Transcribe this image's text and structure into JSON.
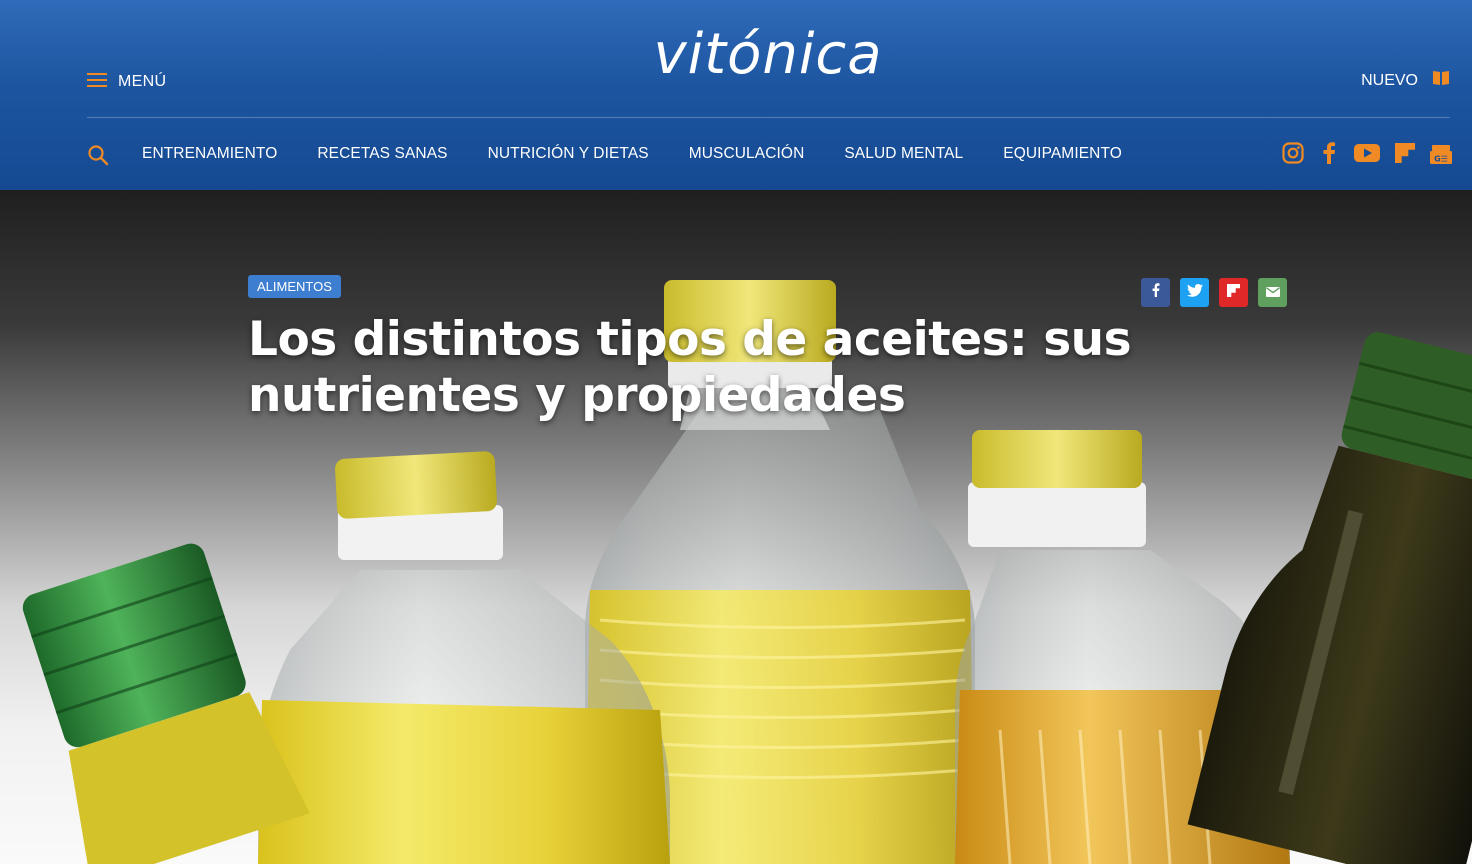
{
  "header": {
    "menu_label": "MENÚ",
    "logo_text": "vitónica",
    "nuevo_label": "NUEVO",
    "accent_color": "#f08a24"
  },
  "nav": {
    "items": [
      {
        "label": "ENTRENAMIENTO"
      },
      {
        "label": "RECETAS SANAS"
      },
      {
        "label": "NUTRICIÓN Y DIETAS"
      },
      {
        "label": "MUSCULACIÓN"
      },
      {
        "label": "SALUD MENTAL"
      },
      {
        "label": "EQUIPAMIENTO"
      }
    ],
    "socials": [
      "instagram-icon",
      "facebook-icon",
      "youtube-icon",
      "flipboard-icon",
      "google-news-icon"
    ]
  },
  "article": {
    "category": "ALIMENTOS",
    "title": "Los distintos tipos de aceites: sus nutrientes y propiedades",
    "share": [
      {
        "icon": "facebook-icon",
        "color": "#3b5998"
      },
      {
        "icon": "twitter-icon",
        "color": "#1da1f2"
      },
      {
        "icon": "flipboard-icon",
        "color": "#e12828"
      },
      {
        "icon": "email-icon",
        "color": "#5fa05f"
      }
    ]
  }
}
